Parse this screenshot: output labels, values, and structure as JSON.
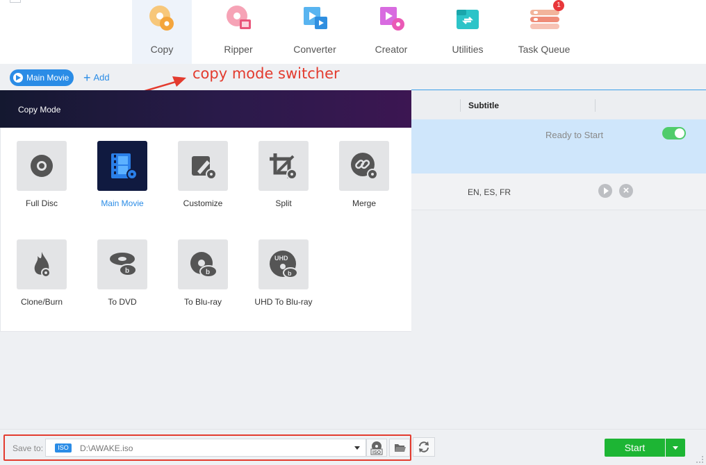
{
  "nav": {
    "items": [
      {
        "label": "Copy",
        "icon": "copy-disc-icon",
        "active": true
      },
      {
        "label": "Ripper",
        "icon": "ripper-disc-icon"
      },
      {
        "label": "Converter",
        "icon": "converter-film-icon"
      },
      {
        "label": "Creator",
        "icon": "creator-film-disc-icon"
      },
      {
        "label": "Utilities",
        "icon": "utilities-toolbox-icon"
      },
      {
        "label": "Task Queue",
        "icon": "task-queue-stack-icon",
        "badge": "1"
      }
    ]
  },
  "mode_switcher": {
    "current_mode": "Main Movie",
    "add_label": "Add"
  },
  "annotation": {
    "text": "copy mode switcher",
    "color": "#e33b2e"
  },
  "copy_mode_panel": {
    "title": "Copy Mode",
    "modes": [
      {
        "label": "Full Disc",
        "icon": "disc-icon"
      },
      {
        "label": "Main Movie",
        "icon": "film-strip-icon",
        "active": true
      },
      {
        "label": "Customize",
        "icon": "edit-pencil-icon"
      },
      {
        "label": "Split",
        "icon": "crop-split-icon"
      },
      {
        "label": "Merge",
        "icon": "link-merge-icon"
      },
      {
        "label": "Clone/Burn",
        "icon": "flame-icon"
      },
      {
        "label": "To DVD",
        "icon": "dvd-disc-icon"
      },
      {
        "label": "To Blu-ray",
        "icon": "bluray-disc-icon"
      },
      {
        "label": "UHD To Blu-ray",
        "icon": "uhd-bluray-icon"
      }
    ]
  },
  "table": {
    "subtitle_header": "Subtitle",
    "status": "Ready to Start",
    "subtitles_value": "EN, ES, FR"
  },
  "bottom": {
    "save_to_label": "Save to:",
    "format_tag": "ISO",
    "path": "D:\\AWAKE.iso",
    "start_label": "Start"
  },
  "colors": {
    "accent": "#2a8ce6",
    "start_green": "#1db534",
    "toggle_green": "#4fcc6b",
    "highlight_row": "#cfe6fb"
  }
}
